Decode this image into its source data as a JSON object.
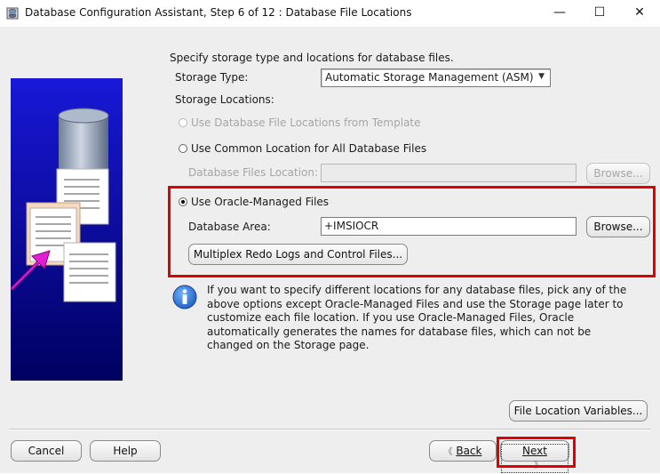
{
  "window": {
    "title": "Database Configuration Assistant, Step 6 of 12 : Database File Locations",
    "minimize_glyph": "—",
    "maximize_glyph": "☐",
    "close_glyph": "✕"
  },
  "main": {
    "heading": "Specify storage type and locations for database files.",
    "storage_type_label": "Storage Type:",
    "storage_type_value": "Automatic Storage Management (ASM)",
    "storage_locations_label": "Storage Locations:",
    "option_template": "Use Database File Locations from Template",
    "option_common": "Use Common Location for All Database Files",
    "db_files_location_label": "Database Files Location:",
    "db_files_location_value": "",
    "browse_label": "Browse...",
    "option_omf": "Use Oracle-Managed Files",
    "database_area_label": "Database Area:",
    "database_area_value": "+IMSIOCR",
    "browse2_label": "Browse...",
    "multiplex_label": "Multiplex Redo Logs and Control Files...",
    "info_text": "If you want to specify different locations for any database files, pick any of the above options except Oracle-Managed Files and use the Storage page later to customize each file location. If you use Oracle-Managed Files, Oracle automatically generates the names for database files, which can not be changed on the Storage page.",
    "file_location_vars_label": "File Location Variables..."
  },
  "footer": {
    "cancel": "Cancel",
    "help": "Help",
    "back_arrow": "《",
    "back": "Back",
    "next": "Next",
    "next_arrow": "》"
  },
  "state": {
    "selected_option": "Use Oracle-Managed Files"
  },
  "colors": {
    "highlight": "#e00000",
    "background": "#eeeeee",
    "info_icon": "#1f6fd6"
  }
}
